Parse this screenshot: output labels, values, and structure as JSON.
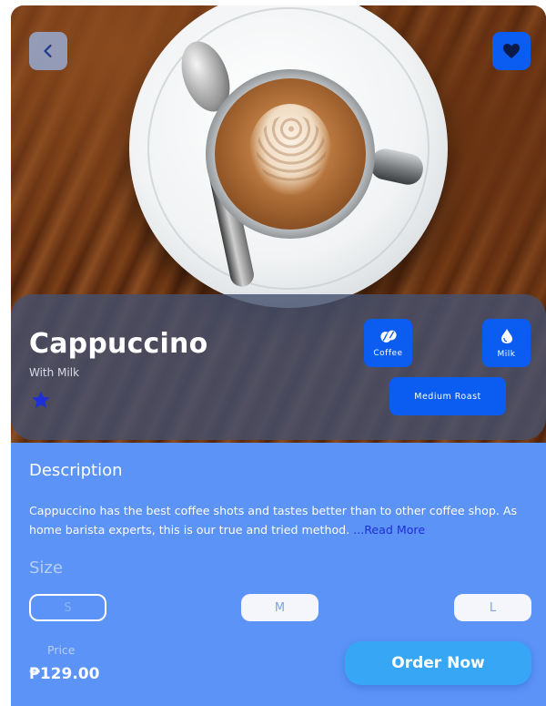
{
  "product": {
    "name": "Cappuccino",
    "subtitle": "With Milk",
    "rating_stars": 1
  },
  "tags": {
    "coffee": "Coffee",
    "milk": "Milk",
    "roast": "Medium Roast"
  },
  "description": {
    "heading": "Description",
    "text": "Cappuccino has the best coffee shots and tastes better than to other coffee shop. As home barista experts, this is our true and tried method. ",
    "read_more": "...Read More"
  },
  "size": {
    "heading": "Size",
    "options": [
      "S",
      "M",
      "L"
    ],
    "selected": "S"
  },
  "price": {
    "label": "Price",
    "value": "₱129.00"
  },
  "actions": {
    "order_label": "Order Now"
  },
  "icons": {
    "back": "chevron-left-icon",
    "favorite": "heart-icon",
    "coffee": "coffee-beans-icon",
    "milk": "drop-icon",
    "rating": "star-icon"
  },
  "colors": {
    "background": "#5b93f7",
    "accent": "#0b5cf0",
    "order_button": "#37a7f5",
    "read_more": "#1f2fd6"
  }
}
